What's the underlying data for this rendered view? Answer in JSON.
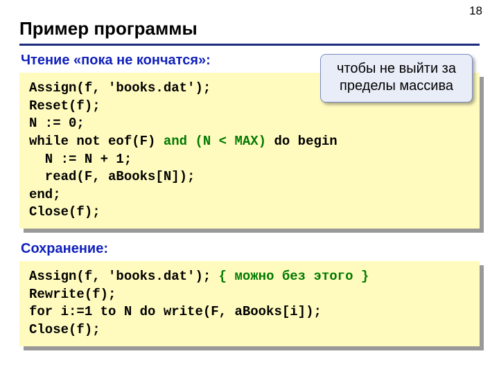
{
  "page_number": "18",
  "title": "Пример программы",
  "section1": {
    "heading": "Чтение «пока не кончатся»:",
    "code": {
      "l1": "Assign(f, 'books.dat');",
      "l2": "Reset(f);",
      "l3": "N := 0;",
      "l4a": "while not eof(F) ",
      "l4b": "and (N < MAX)",
      "l4c": " do begin",
      "l5": "  N := N + 1;",
      "l6": "  read(F, aBooks[N]);",
      "l7": "end;",
      "l8": "Close(f);"
    }
  },
  "callout": "чтобы не выйти за пределы массива",
  "section2": {
    "heading": "Сохранение:",
    "code": {
      "l1a": "Assign(f, 'books.dat'); ",
      "l1b": "{ можно без этого }",
      "l2": "Rewrite(f);",
      "l3": "for i:=1 to N do write(F, aBooks[i]);",
      "l4": "Close(f);"
    }
  }
}
